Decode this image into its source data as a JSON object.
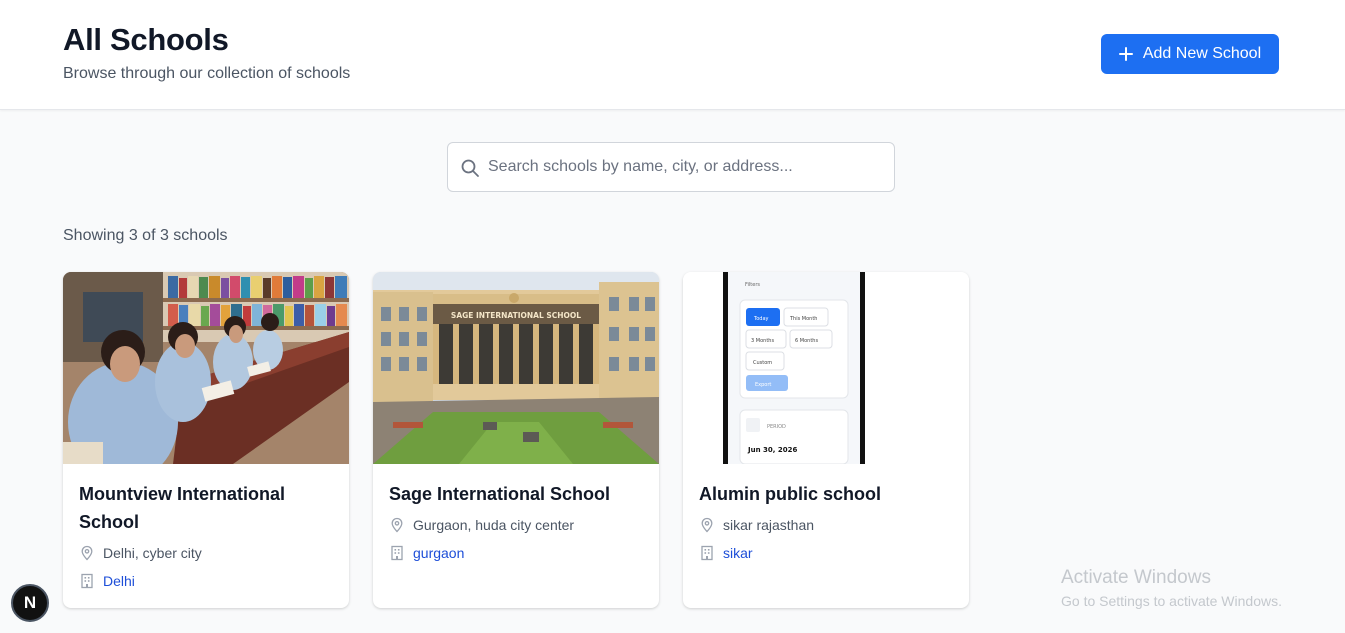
{
  "header": {
    "title": "All Schools",
    "subtitle": "Browse through our collection of schools",
    "add_button_label": "Add New School"
  },
  "search": {
    "placeholder": "Search schools by name, city, or address...",
    "value": ""
  },
  "results": {
    "count_text": "Showing 3 of 3 schools"
  },
  "schools": [
    {
      "name": "Mountview International School",
      "address": "Delhi, cyber city",
      "city": "Delhi"
    },
    {
      "name": "Sage International School",
      "address": "Gurgaon, huda city center",
      "city": "gurgaon"
    },
    {
      "name": "Alumin public school",
      "address": "sikar rajasthan",
      "city": "sikar"
    }
  ],
  "school_images": {
    "sage_sign": "SAGE INTERNATIONAL SCHOOL",
    "phone": {
      "top_text": "Filters",
      "chips": [
        "Today",
        "This Month",
        "3 Months",
        "6 Months",
        "Custom"
      ],
      "apply_label": "Export",
      "period_label": "PERIOD",
      "date": "Jun 30, 2026"
    }
  },
  "watermark": {
    "line1": "Activate Windows",
    "line2": "Go to Settings to activate Windows."
  },
  "next_badge": "N",
  "colors": {
    "primary": "#1d6ff2",
    "link": "#1d4ed8",
    "background": "#f9fafb"
  }
}
